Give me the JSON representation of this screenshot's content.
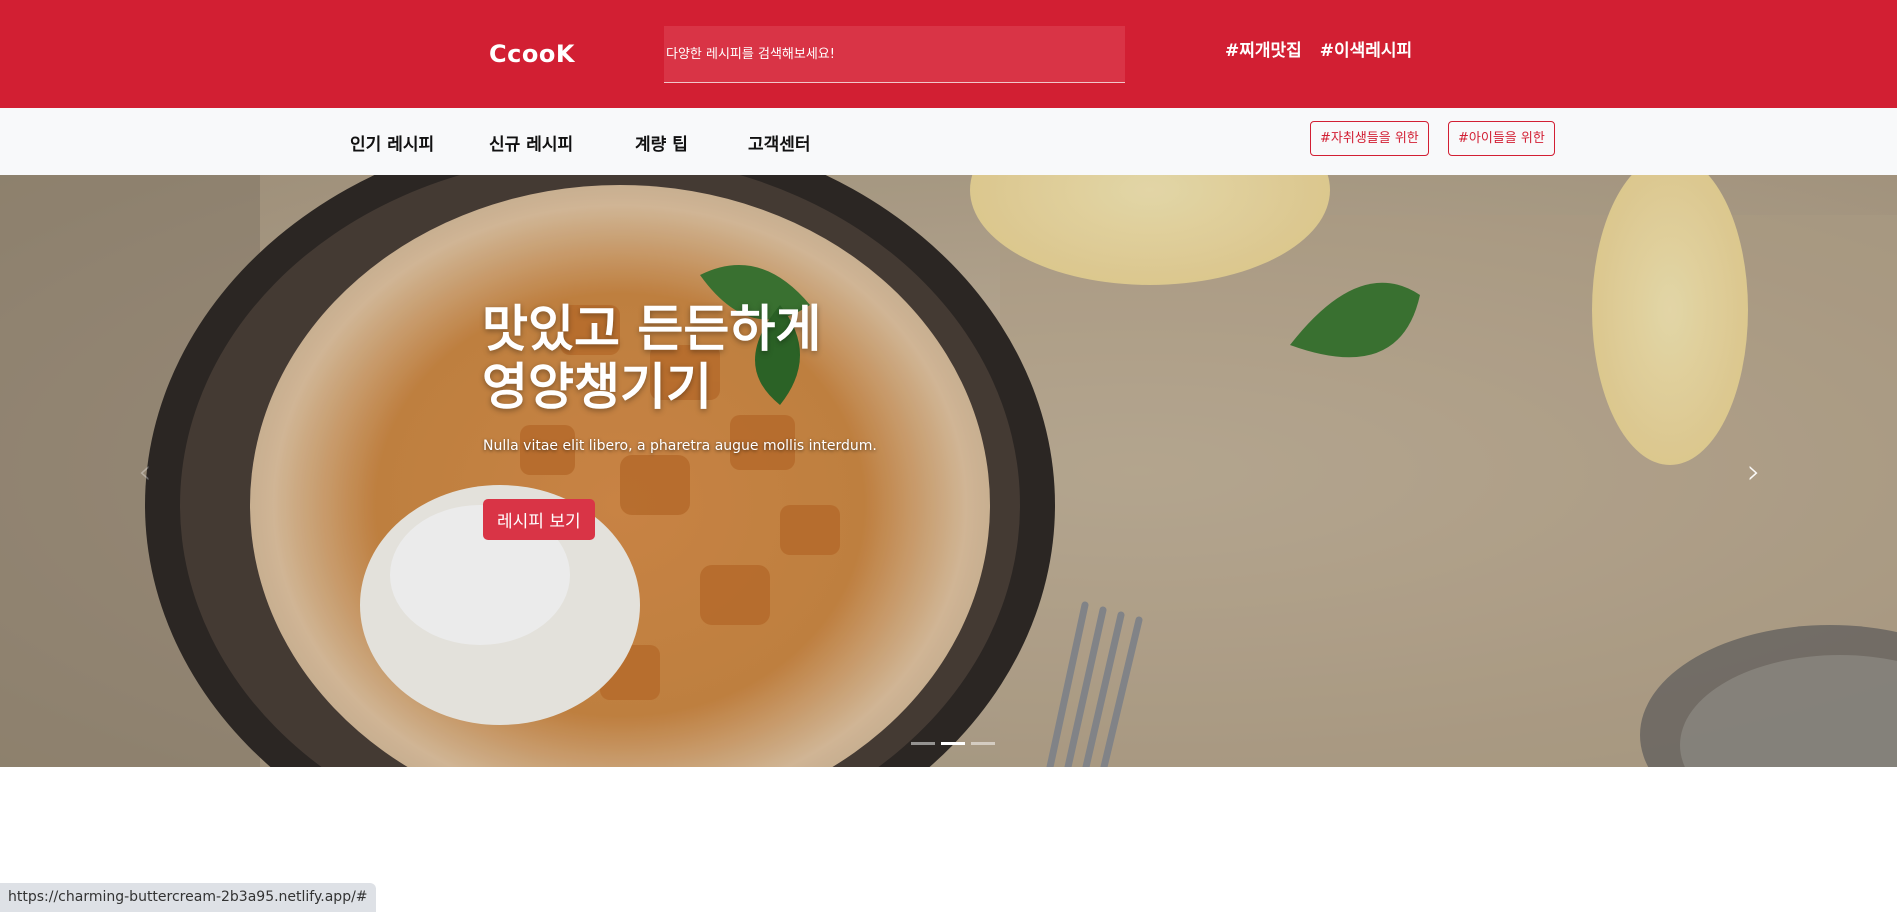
{
  "header": {
    "logo": "CcooK",
    "search_placeholder": "다양한 레시피를 검색해보세요!",
    "hashtags": [
      "#찌개맛집",
      "#이색레시피"
    ]
  },
  "nav": {
    "items": [
      "인기 레시피",
      "신규 레시피",
      "계량 팁",
      "고객센터"
    ],
    "tags": [
      "#자취생들을 위한",
      "#아이들을 위한"
    ]
  },
  "hero": {
    "title_line1": "맛있고 든든하게",
    "title_line2": "영양챙기기",
    "subtitle": "Nulla vitae elit libero, a pharetra augue mollis interdum.",
    "button_label": "레시피 보기",
    "prev_icon": "chevron-left-icon",
    "next_icon": "chevron-right-icon",
    "prev_glyph": "‹",
    "next_glyph": "›",
    "slide_count": 3,
    "active_slide": 2
  },
  "status": {
    "url": "https://charming-buttercream-2b3a95.netlify.app/#"
  },
  "colors": {
    "brand_red": "#d21f33",
    "search_bg": "#d93446",
    "nav_bg": "#f8f9fa"
  }
}
